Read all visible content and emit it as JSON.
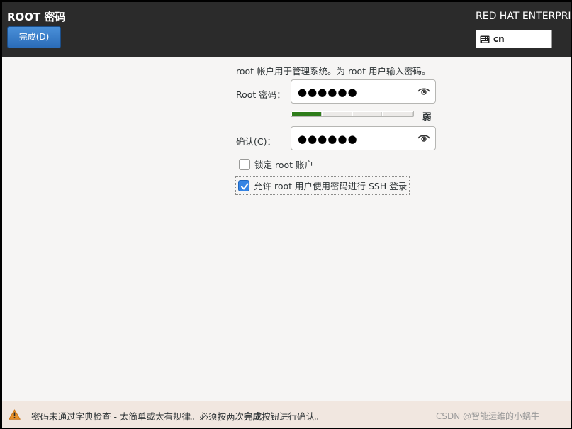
{
  "header": {
    "title": "ROOT 密码",
    "done_button": "完成(D)",
    "product": "RED HAT ENTERPRISE",
    "keyboard_layout": "cn"
  },
  "form": {
    "intro": "root 帐户用于管理系统。为 root 用户输入密码。",
    "root_password_label": "Root 密码：",
    "root_password_value": "●●●●●●",
    "strength": {
      "label": "弱",
      "level_segments": 1,
      "total_segments": 4,
      "color": "#2e7d1a"
    },
    "confirm_label": "确认(C)：",
    "confirm_value": "●●●●●●",
    "lock_root": {
      "label": "锁定 root 账户",
      "checked": false
    },
    "allow_ssh": {
      "label": "允许 root 用户使用密码进行 SSH 登录",
      "checked": true
    }
  },
  "warning": {
    "text_before": "密码未通过字典检查 - 太简单或太有规律。必须按两次",
    "text_bold": "完成",
    "text_after": "按钮进行确认。"
  },
  "watermark": "CSDN @智能运维的小蜗牛",
  "colors": {
    "header_bg": "#2b2b2b",
    "accent": "#3584e4",
    "warning_bg": "#f1e7e0"
  }
}
